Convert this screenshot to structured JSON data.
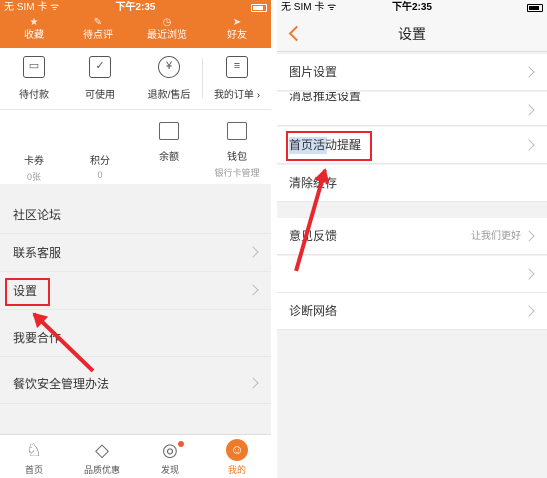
{
  "left": {
    "status": {
      "carrier": "无 SIM 卡 ᯤ",
      "time": "下午2:35"
    },
    "top_nav": [
      {
        "label": "收藏",
        "icon": "star-icon",
        "glyph": "★"
      },
      {
        "label": "待点评",
        "icon": "comment-icon",
        "glyph": "✎"
      },
      {
        "label": "最近浏览",
        "icon": "clock-icon",
        "glyph": "◷"
      },
      {
        "label": "好友",
        "icon": "compass-icon",
        "glyph": "➤"
      }
    ],
    "orders": [
      {
        "label": "待付款",
        "icon": "wallet-icon",
        "glyph": "▭"
      },
      {
        "label": "可使用",
        "icon": "check-icon",
        "glyph": "✓"
      },
      {
        "label": "退款/售后",
        "icon": "refund-icon",
        "glyph": "¥"
      },
      {
        "label": "我的订单 ›",
        "icon": "order-list-icon",
        "glyph": "≡"
      }
    ],
    "wallet": [
      {
        "label": "卡券",
        "sub": "0张",
        "icon": "coupon-icon"
      },
      {
        "label": "积分",
        "sub": "0",
        "icon": "points-icon"
      },
      {
        "label": "余额",
        "sub": "",
        "icon": "balance-icon"
      },
      {
        "label": "钱包",
        "sub": "银行卡管理",
        "icon": "purse-icon"
      }
    ],
    "menu": [
      {
        "label": "社区论坛",
        "chevron": false
      },
      {
        "label": "联系客服",
        "chevron": true
      },
      {
        "label": "设置",
        "chevron": true
      },
      {
        "label": "我要合作",
        "chevron": false
      },
      {
        "label": "餐饮安全管理办法",
        "chevron": true
      }
    ],
    "tabs": [
      {
        "label": "首页",
        "icon": "home-icon",
        "glyph": "♘",
        "active": false
      },
      {
        "label": "品质优惠",
        "icon": "diamond-icon",
        "glyph": "◇",
        "active": false
      },
      {
        "label": "发现",
        "icon": "discover-icon",
        "glyph": "◎",
        "active": false,
        "badge": true
      },
      {
        "label": "我的",
        "icon": "profile-icon",
        "glyph": "☺",
        "active": true
      }
    ],
    "accent": "#ee7a2b"
  },
  "right": {
    "status": {
      "carrier": "无 SIM 卡 ᯤ",
      "time": "下午2:35"
    },
    "nav_title": "设置",
    "rows": [
      {
        "label": "图片设置",
        "value": "",
        "chevron": true
      },
      {
        "label": "消息推送设置",
        "value": "",
        "chevron": true
      },
      {
        "label": "首页活动提醒",
        "value": "",
        "chevron": true
      },
      {
        "label": "清除缓存",
        "value": "",
        "chevron": false
      },
      {
        "label": "意见反馈",
        "value": "让我们更好",
        "chevron": true
      },
      {
        "label": "",
        "value": "",
        "chevron": true
      },
      {
        "label": "诊断网络",
        "value": "",
        "chevron": true
      }
    ]
  },
  "annotation_color": "#e8262d"
}
